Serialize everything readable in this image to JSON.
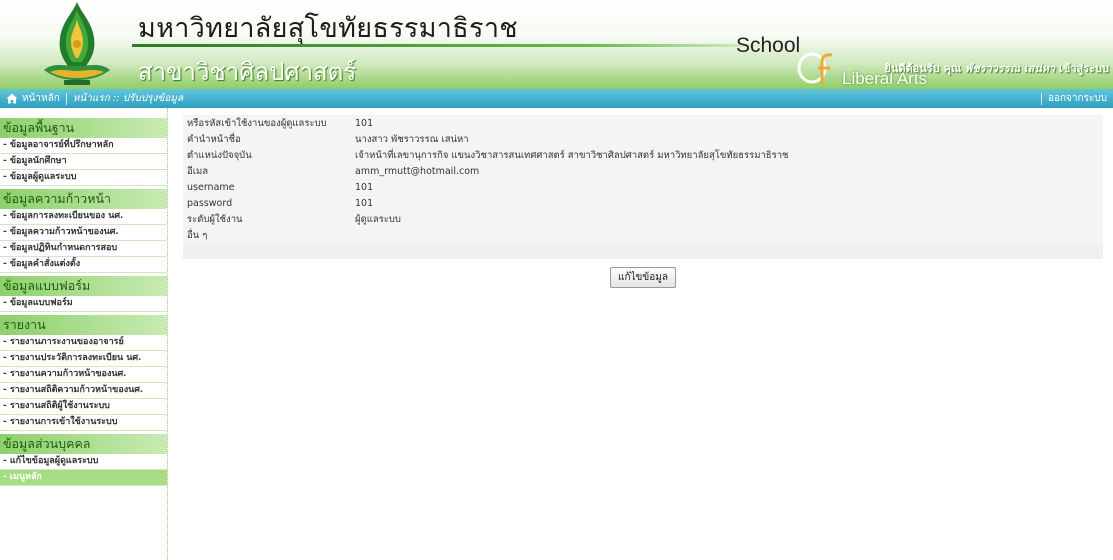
{
  "header": {
    "university_name": "มหาวิทยาลัยสุโขทัยธรรมาธิราช",
    "department_name": "สาขาวิชาศิลปศาสตร์",
    "school_text": "School",
    "liberal_arts_text": "Liberal Arts",
    "welcome_prefix": "ยินดีต้อนรับ คุณ",
    "welcome_name": "พัชราวรรณ เสน่หา",
    "welcome_suffix": "เข้าสู่ระบบ"
  },
  "nav": {
    "home_label": "หน้าหลัก",
    "breadcrumb": "หน้าแรก :: ปรับปรุงข้อมูล",
    "logout_label": "ออกจากระบบ"
  },
  "sidebar": {
    "sections": [
      {
        "title": "ข้อมูลพื้นฐาน",
        "items": [
          "- ข้อมูลอาจารย์ที่ปรึกษาหลัก",
          "- ข้อมูลนักศึกษา",
          "- ข้อมูลผู้ดูแลระบบ"
        ]
      },
      {
        "title": "ข้อมูลความก้าวหน้า",
        "items": [
          "- ข้อมูลการลงทะเบียนของ นศ.",
          "- ข้อมูลความก้าวหน้าของนศ.",
          "- ข้อมูลปฏิทินกำหนดการสอบ",
          "- ข้อมูลคำสั่งแต่งตั้ง"
        ]
      },
      {
        "title": "ข้อมูลแบบฟอร์ม",
        "items": [
          "- ข้อมูลแบบฟอร์ม"
        ]
      },
      {
        "title": "รายงาน",
        "items": [
          "- รายงานภาระงานของอาจารย์",
          "- รายงานประวัติการลงทะเบียน นศ.",
          "- รายงานความก้าวหน้าของนศ.",
          "- รายงานสถิติความก้าวหน้าของนศ.",
          "- รายงานสถิติผู้ใช้งานระบบ",
          "- รายงานการเข้าใช้งานระบบ"
        ]
      },
      {
        "title": "ข้อมูลส่วนบุคคล",
        "items": [
          "- แก้ไขข้อมูลผู้ดูแลระบบ",
          "- เมนูหลัก"
        ]
      }
    ]
  },
  "profile": {
    "rows": [
      {
        "label": "หรือรหัสเข้าใช้งานของผู้ดูแลระบบ",
        "value": "101"
      },
      {
        "label": "คำนำหน้าชื่อ",
        "value": "นางสาว พัชราวรรณ เสน่หา"
      },
      {
        "label": "ตำแหน่งปัจจุบัน",
        "value": "เจ้าหน้าที่เลขานุการกิจ แขนงวิชาสารสนเทศศาสตร์ สาขาวิชาศิลปศาสตร์ มหาวิทยาลัยสุโขทัยธรรมาธิราช"
      },
      {
        "label": "อีเมล",
        "value": "amm_rmutt@hotmail.com"
      },
      {
        "label": "username",
        "value": "101"
      },
      {
        "label": "password",
        "value": "101"
      },
      {
        "label": "ระดับผู้ใช้งาน",
        "value": "ผู้ดูแลระบบ"
      },
      {
        "label": "อื่น ๆ",
        "value": ""
      }
    ],
    "edit_button_label": "แก้ไขข้อมูล"
  },
  "colors": {
    "header_green": "#8fcd66",
    "nav_blue": "#2d9fbd",
    "sidebar_heading": "#8dd06a",
    "active_item": "#a7dd82"
  },
  "icons": [
    "university-emblem-icon",
    "home-icon",
    "of-swoosh-icon"
  ]
}
